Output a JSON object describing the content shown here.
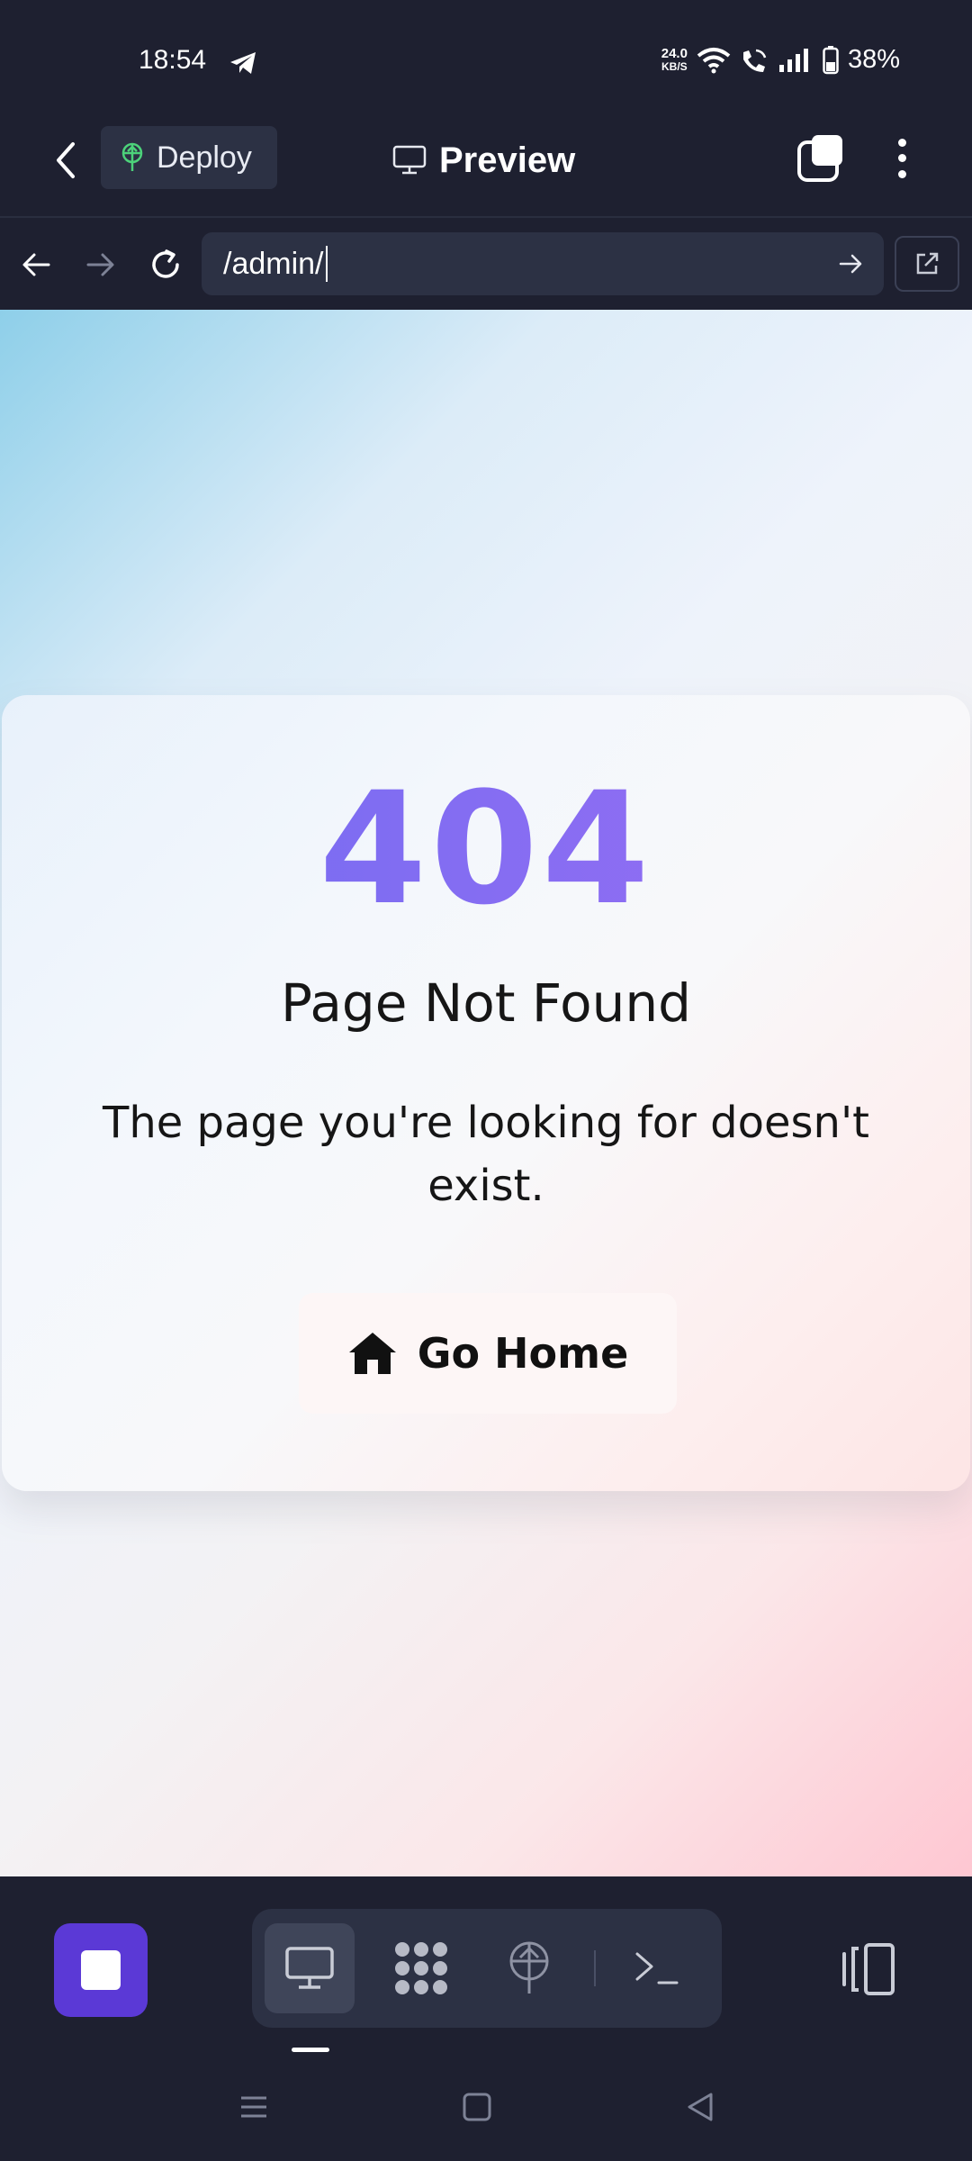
{
  "status_bar": {
    "time": "18:54",
    "net_speed_value": "24.0",
    "net_speed_unit": "KB/S",
    "battery": "38%"
  },
  "app_bar": {
    "deploy_label": "Deploy",
    "title": "Preview"
  },
  "url_bar": {
    "url": "/admin/"
  },
  "page": {
    "code": "404",
    "title": "Page Not Found",
    "message": "The page you're looking for doesn't exist.",
    "home_button_label": "Go Home"
  },
  "toolbar": {
    "items": [
      "monitor-icon",
      "grid-dots-icon",
      "antenna-icon",
      "terminal-icon"
    ],
    "active_item": "monitor-icon"
  },
  "colors": {
    "chrome_bg": "#1e2030",
    "field_bg": "#2c3144",
    "accent": "#5b39d6",
    "code_gradient_start": "#6f6cf2",
    "code_gradient_end": "#9b6ef3",
    "deploy_icon": "#4cd27a"
  }
}
